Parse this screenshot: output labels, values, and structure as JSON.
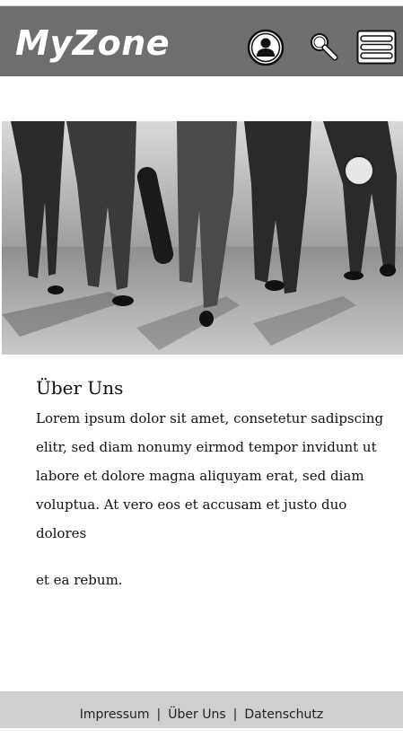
{
  "header": {
    "logo": "MyZone",
    "background_color": "#6e6e6e",
    "icons": [
      "user-icon",
      "search-icon",
      "menu-icon"
    ]
  },
  "hero": {
    "image": "group-of-teens-walking-photo"
  },
  "about": {
    "title": "Über Uns",
    "body": "Lorem ipsum dolor sit amet, consetetur sadipscing elitr, sed diam nonumy eirmod tempor invidunt ut labore et dolore magna aliquyam erat, sed diam voluptua. At vero eos et accusam et justo duo dolores",
    "tail": "et ea rebum."
  },
  "footer": {
    "links": [
      "Impressum",
      "Über Uns",
      "Datenschutz"
    ],
    "separator": "|"
  }
}
